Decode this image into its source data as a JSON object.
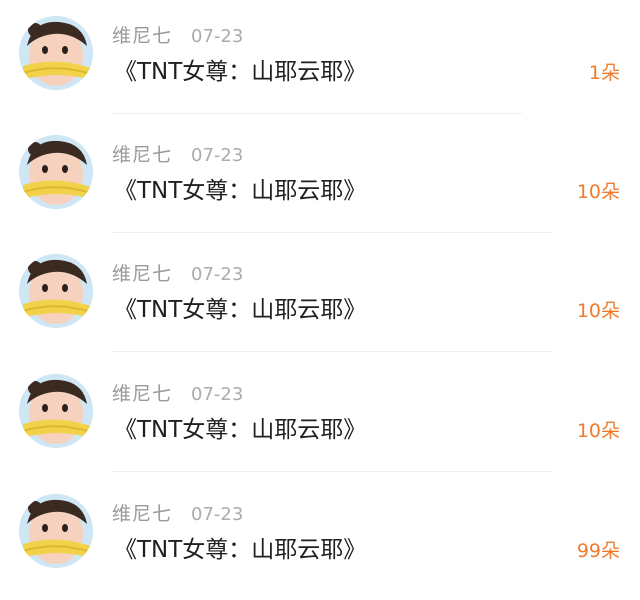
{
  "colors": {
    "amount": "#ef7b2e",
    "name": "#9a9a9a",
    "date": "#ababab",
    "title": "#1f1f1f",
    "divider": "#efefef"
  },
  "entries": [
    {
      "avatar_icon": "avatar-icon",
      "name": "维尼七",
      "date": "07-23",
      "title": "《TNT女尊：山耶云耶》",
      "amount": "1朵"
    },
    {
      "avatar_icon": "avatar-icon",
      "name": "维尼七",
      "date": "07-23",
      "title": "《TNT女尊：山耶云耶》",
      "amount": "10朵"
    },
    {
      "avatar_icon": "avatar-icon",
      "name": "维尼七",
      "date": "07-23",
      "title": "《TNT女尊：山耶云耶》",
      "amount": "10朵"
    },
    {
      "avatar_icon": "avatar-icon",
      "name": "维尼七",
      "date": "07-23",
      "title": "《TNT女尊：山耶云耶》",
      "amount": "10朵"
    },
    {
      "avatar_icon": "avatar-icon",
      "name": "维尼七",
      "date": "07-23",
      "title": "《TNT女尊：山耶云耶》",
      "amount": "99朵"
    }
  ]
}
